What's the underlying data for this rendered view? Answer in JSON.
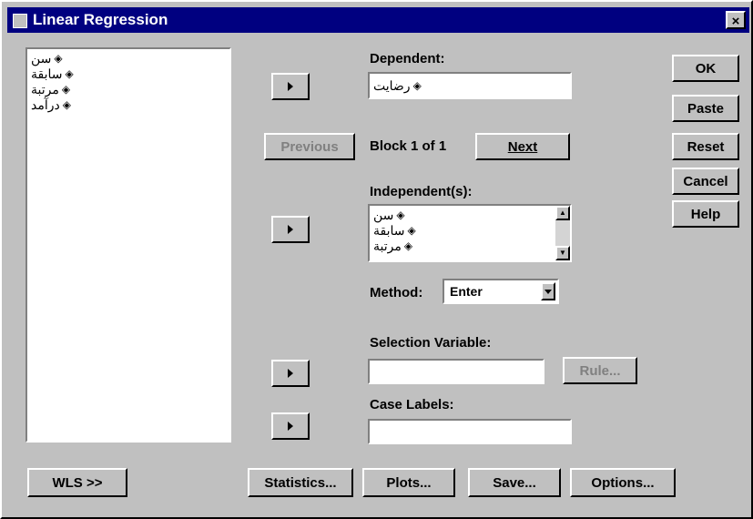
{
  "window": {
    "title": "Linear Regression",
    "close_glyph": "×"
  },
  "source_list": {
    "items": [
      {
        "label": "سن",
        "icon": "ruler-icon"
      },
      {
        "label": "سابقة",
        "icon": "ruler-icon"
      },
      {
        "label": "مرتبة",
        "icon": "ruler-icon"
      },
      {
        "label": "درآمد",
        "icon": "ruler-icon"
      }
    ]
  },
  "dependent": {
    "label": "Dependent:",
    "value": "رضايت",
    "icon": "ruler-icon"
  },
  "block": {
    "previous_label": "Previous",
    "status": "Block 1 of 1",
    "next_label": "Next"
  },
  "independents": {
    "label": "Independent(s):",
    "items": [
      {
        "label": "سن",
        "icon": "ruler-icon"
      },
      {
        "label": "سابقة",
        "icon": "ruler-icon"
      },
      {
        "label": "مرتبة",
        "icon": "ruler-icon"
      }
    ]
  },
  "method": {
    "label": "Method:",
    "value": "Enter"
  },
  "selection": {
    "label": "Selection Variable:",
    "rule_label": "Rule...",
    "value": ""
  },
  "case_labels": {
    "label": "Case Labels:",
    "value": ""
  },
  "side_buttons": {
    "ok": "OK",
    "paste": "Paste",
    "reset": "Reset",
    "cancel": "Cancel",
    "help": "Help"
  },
  "bottom_buttons": {
    "wls": "WLS >>",
    "statistics": "Statistics...",
    "plots": "Plots...",
    "save": "Save...",
    "options": "Options..."
  },
  "colors": {
    "title_bar": "#000080",
    "dialog_bg": "#c0c0c0",
    "field_bg": "#ffffff"
  }
}
